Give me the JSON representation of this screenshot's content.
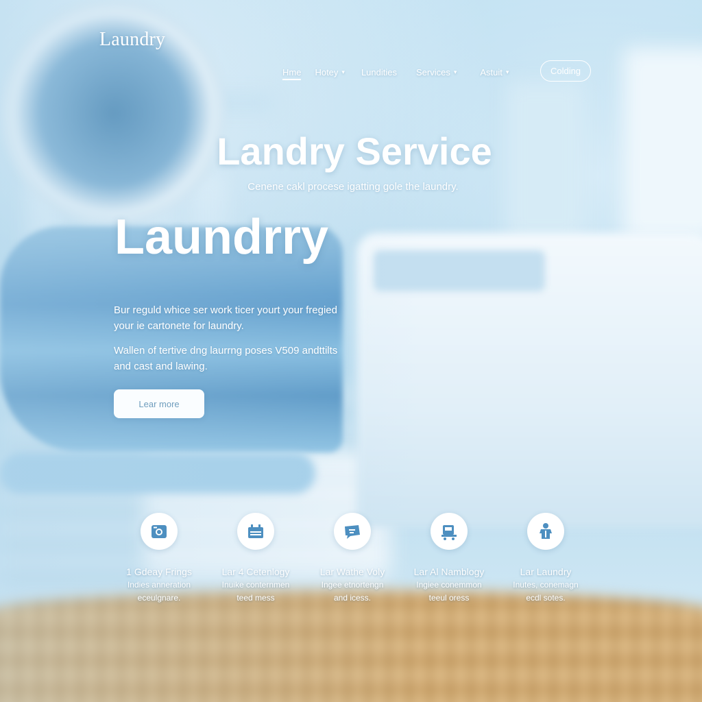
{
  "brand": {
    "logo": "Laundry"
  },
  "nav": {
    "items": [
      {
        "label": "Hme",
        "has_dropdown": false,
        "active": true
      },
      {
        "label": "Hotey",
        "has_dropdown": true,
        "active": false
      },
      {
        "label": "Lundities",
        "has_dropdown": false,
        "active": false
      },
      {
        "label": "Services",
        "has_dropdown": true,
        "active": false
      },
      {
        "label": "Astuit",
        "has_dropdown": true,
        "active": false
      }
    ],
    "chevron": "⌄",
    "cta_label": "Colding"
  },
  "hero": {
    "title": "Landry Service",
    "subtitle": "Cenene cakl procese igatting gole the laundry.",
    "big_title": "Laundrry",
    "paragraph_1": "Bur reguld whice ser work ticer yourt your fregied your ie cartonete for laundry.",
    "paragraph_2": "Wallen of tertive dng laurrng poses V509 andttilts and cast and lawing.",
    "learn_more_label": "Lear more"
  },
  "features": [
    {
      "icon": "washer-icon",
      "title": "1 Gdeay Frings",
      "desc_1": "Indies anneration",
      "desc_2": "eceulgnare."
    },
    {
      "icon": "basket-icon",
      "title": "Lar 4 Cetenlogy",
      "desc_1": "Inuike conternmen",
      "desc_2": "teed mess"
    },
    {
      "icon": "chat-icon",
      "title": "Lar Wathe Voly",
      "desc_1": "Ingee etnortengn",
      "desc_2": "and icess."
    },
    {
      "icon": "cart-icon",
      "title": "Lar Al Namblogy",
      "desc_1": "Ingiee conemmon",
      "desc_2": "teeul oress"
    },
    {
      "icon": "shirt-icon",
      "title": "Lar Laundry",
      "desc_1": "Inutes, conemagn",
      "desc_2": "ecdl sotes."
    }
  ],
  "colors": {
    "accent": "#5b9bc9",
    "icon_fill": "#4d8fc0",
    "button_text": "#6f9dbd"
  }
}
